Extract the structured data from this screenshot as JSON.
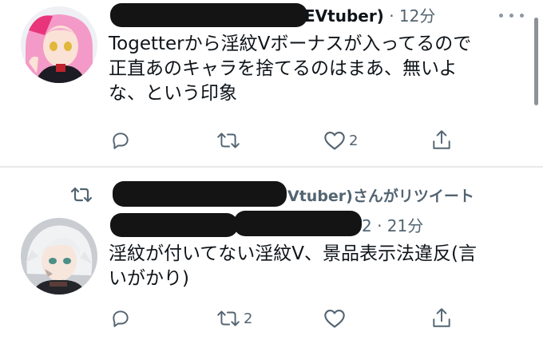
{
  "tweets": [
    {
      "author_name_visible": "EVtuber)",
      "timestamp": "· 12分",
      "text_lines": [
        "Togetterから淫紋Vボーナスが入ってるので",
        "正直あのキャラを捨てるのはまあ、無いよ",
        "な、という印象"
      ],
      "actions": {
        "reply": "",
        "retweet": "",
        "like": "2",
        "share": ""
      }
    },
    {
      "retweet_context": "Vtuber)さんがリツイート",
      "timestamp": "2 · 21分",
      "text_lines": [
        "淫紋が付いてない淫紋V、景品表示法違反(言",
        "いがかり)"
      ],
      "actions": {
        "reply": "",
        "retweet": "2",
        "like": "",
        "share": ""
      }
    }
  ],
  "colors": {
    "text": "#0f1419",
    "secondary": "#536471",
    "divider": "#e7e9ea",
    "redaction": "#141414"
  }
}
